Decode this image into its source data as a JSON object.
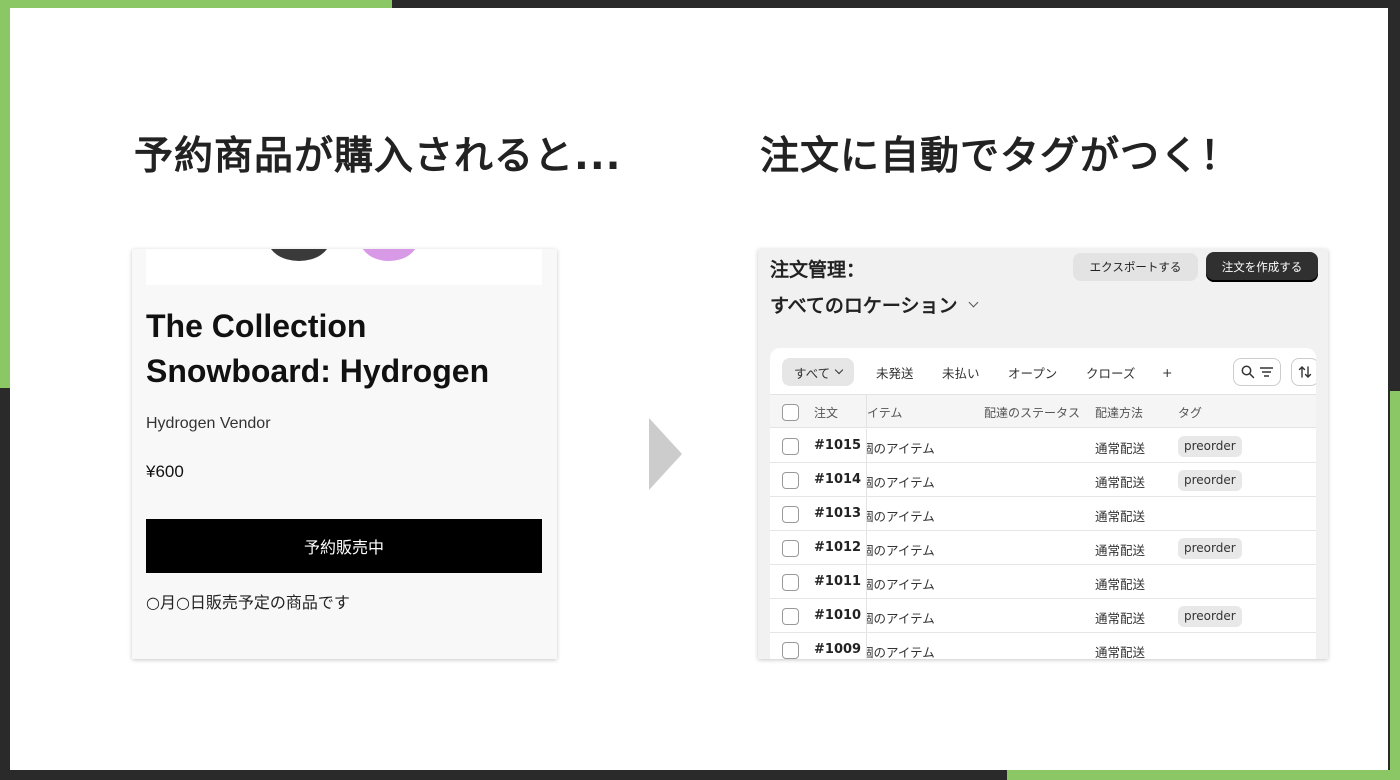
{
  "colors": {
    "accent_green": "#8bc765",
    "frame_dark": "#2a2a2a",
    "arrow_gray": "#cccccc"
  },
  "headings": {
    "left": "予約商品が購入されると...",
    "right": "注文に自動でタグがつく！"
  },
  "product": {
    "swatch_colors": [
      "#3a3a3a",
      "#d89ae6"
    ],
    "title": "The Collection Snowboard: Hydrogen",
    "vendor": "Hydrogen Vendor",
    "price": "¥600",
    "button_label": "予約販売中",
    "release_note": "○月○日販売予定の商品です"
  },
  "orders": {
    "title": "注文管理：",
    "export_label": "エクスポートする",
    "create_label": "注文を作成する",
    "location": "すべてのロケーション",
    "tabs": [
      {
        "label": "すべて"
      },
      {
        "label": "未発送"
      },
      {
        "label": "未払い"
      },
      {
        "label": "オープン"
      },
      {
        "label": "クローズ"
      },
      {
        "label": "+"
      }
    ],
    "columns": {
      "order": "注文",
      "items": "イテム",
      "delivery_status": "配達のステータス",
      "delivery_method": "配達方法",
      "tag": "タグ"
    },
    "rows": [
      {
        "order": "#1015",
        "items": "個のアイテム",
        "method": "通常配送",
        "tag": "preorder"
      },
      {
        "order": "#1014",
        "items": "個のアイテム",
        "method": "通常配送",
        "tag": "preorder"
      },
      {
        "order": "#1013",
        "items": "個のアイテム",
        "method": "通常配送",
        "tag": ""
      },
      {
        "order": "#1012",
        "items": "個のアイテム",
        "method": "通常配送",
        "tag": "preorder"
      },
      {
        "order": "#1011",
        "items": "個のアイテム",
        "method": "通常配送",
        "tag": ""
      },
      {
        "order": "#1010",
        "items": "個のアイテム",
        "method": "通常配送",
        "tag": "preorder"
      },
      {
        "order": "#1009",
        "items": "個のアイテム",
        "method": "通常配送",
        "tag": ""
      }
    ]
  }
}
